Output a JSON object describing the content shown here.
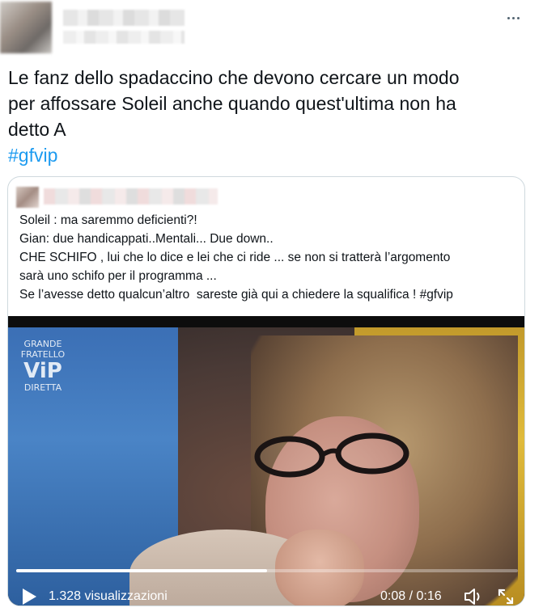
{
  "tweet": {
    "text_line1": "Le fanz dello spadaccino che devono cercare un modo",
    "text_line2": "per affossare Soleil anche quando quest'ultima non ha",
    "text_line3": "detto A",
    "hashtag": "#gfvip",
    "more_icon": "more-horizontal-icon"
  },
  "quoted_tweet": {
    "lines": [
      "Soleil : ma saremmo deficienti?!",
      "Gian: due handicappati..Mentali... Due down..",
      "CHE SCHIFO , lui che lo dice e lei che ci ride ... se non si tratterà l’argomento",
      "sarà uno schifo per il programma ...",
      "Se l’avesse detto qualcun’altro  sareste già qui a chiedere la squalifica ! #gfvip"
    ],
    "video": {
      "logo_top": "GRANDE FRATELLO",
      "logo_main": "ViP",
      "logo_bottom": "DIRETTA",
      "progress": 0.5,
      "views": "1.328 visualizzazioni",
      "time": "0:08 / 0:16",
      "play_icon": "play-icon",
      "volume_icon": "volume-icon",
      "fullscreen_icon": "fullscreen-icon"
    }
  }
}
